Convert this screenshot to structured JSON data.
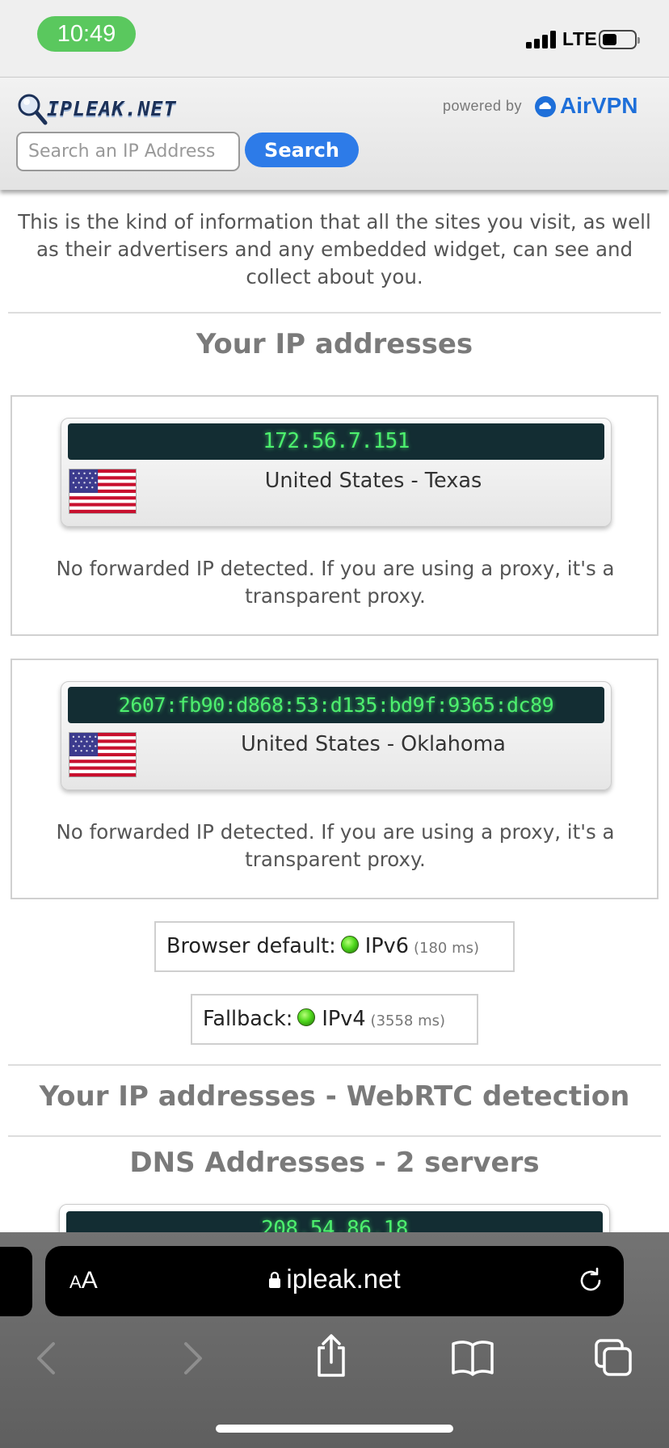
{
  "status_bar": {
    "time": "10:49",
    "network": "LTE"
  },
  "header": {
    "logo_text": "IPLEAK.NET",
    "powered_by": "powered by",
    "airvpn_brand": "AirVPN",
    "search_placeholder": "Search an IP Address",
    "search_button": "Search"
  },
  "intro_text": "This is the kind of information that all the sites you visit, as well as their advertisers and any embedded widget, can see and collect about you.",
  "ip_section": {
    "title": "Your IP addresses",
    "entries": [
      {
        "ip": "172.56.7.151",
        "location": "United States - Texas",
        "note": "No forwarded IP detected. If you are using a proxy, it's a transparent proxy.",
        "flag": "us-flag-icon"
      },
      {
        "ip": "2607:fb90:d868:53:d135:bd9f:9365:dc89",
        "location": "United States - Oklahoma",
        "note": "No forwarded IP detected. If you are using a proxy, it's a transparent proxy.",
        "flag": "us-flag-icon"
      }
    ],
    "browser_default": {
      "label": "Browser default:",
      "protocol": "IPv6",
      "time": "(180 ms)"
    },
    "fallback": {
      "label": "Fallback:",
      "protocol": "IPv4",
      "time": "(3558 ms)"
    }
  },
  "webrtc_section": {
    "title": "Your IP addresses - WebRTC detection"
  },
  "dns_section": {
    "title": "DNS Addresses - 2 servers",
    "first_ip": "208.54.86.18"
  },
  "browser": {
    "aa_small": "A",
    "aa_big": "A",
    "url": "ipleak.net"
  },
  "colors": {
    "search_button": "#2d7be8",
    "ip_text": "#4df06e",
    "ip_background": "#132d33",
    "time_pill": "#5ac85e",
    "airvpn_blue": "#1e6fd9"
  }
}
